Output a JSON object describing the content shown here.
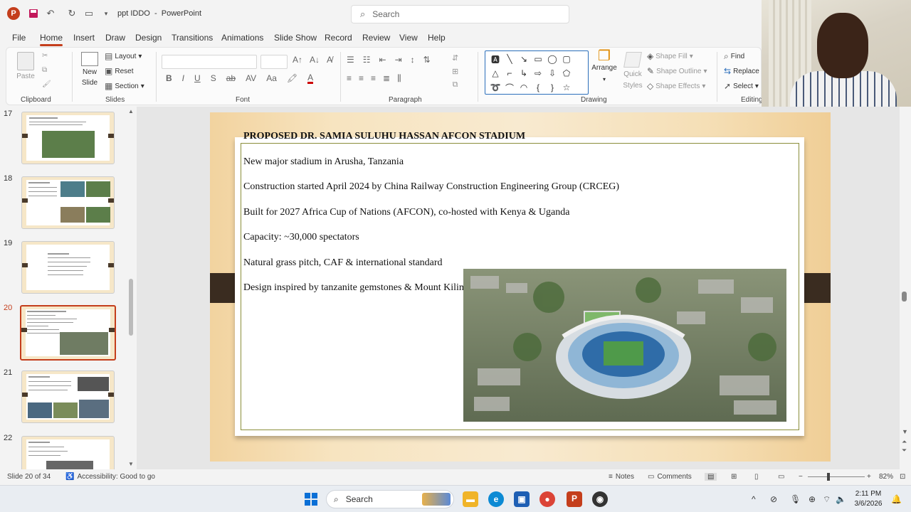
{
  "titlebar": {
    "doc_title": "ppt IDDO",
    "app_name": "PowerPoint",
    "search_placeholder": "Search"
  },
  "menu": [
    "File",
    "Home",
    "Insert",
    "Draw",
    "Design",
    "Transitions",
    "Animations",
    "Slide Show",
    "Record",
    "Review",
    "View",
    "Help"
  ],
  "menu_active": "Home",
  "ribbon": {
    "clipboard": {
      "paste": "Paste",
      "label": "Clipboard"
    },
    "slides": {
      "new_slide": "New",
      "new_slide2": "Slide",
      "layout": "Layout",
      "reset": "Reset",
      "section": "Section",
      "label": "Slides"
    },
    "font": {
      "label": "Font"
    },
    "paragraph": {
      "label": "Paragraph"
    },
    "drawing": {
      "arrange": "Arrange",
      "quick_styles": "Quick",
      "quick_styles2": "Styles",
      "shape_fill": "Shape Fill",
      "shape_outline": "Shape Outline",
      "shape_effects": "Shape Effects",
      "label": "Drawing"
    },
    "editing": {
      "find": "Find",
      "replace": "Replace",
      "select": "Select",
      "label": "Editing"
    }
  },
  "thumbnails": [
    {
      "num": "17"
    },
    {
      "num": "18"
    },
    {
      "num": "19"
    },
    {
      "num": "20"
    },
    {
      "num": "21"
    },
    {
      "num": "22"
    }
  ],
  "active_slide_num": "20",
  "slide": {
    "title": "PROPOSED DR. SAMIA SULUHU HASSAN AFCON STADIUM",
    "bullets": [
      "New major stadium in Arusha, Tanzania",
      "Construction started April 2024 by China Railway Construction Engineering Group (CRCEG)",
      "Built for 2027 Africa Cup of Nations (AFCON), co-hosted with Kenya & Uganda",
      "Capacity: ~30,000 spectators",
      "Natural grass pitch, CAF & international standard",
      "Design inspired by tanzanite gemstones & Mount Kilimanjaro"
    ]
  },
  "statusbar": {
    "slide_info": "Slide 20 of 34",
    "accessibility": "Accessibility: Good to go",
    "notes": "Notes",
    "comments": "Comments",
    "zoom": "82%"
  },
  "taskbar": {
    "search": "Search",
    "time": "2:11 PM",
    "date": "3/6/2026"
  },
  "colors": {
    "accent": "#c43e1c",
    "slide_frame": "#8a8e3a",
    "slide_band": "#3a2c20"
  }
}
